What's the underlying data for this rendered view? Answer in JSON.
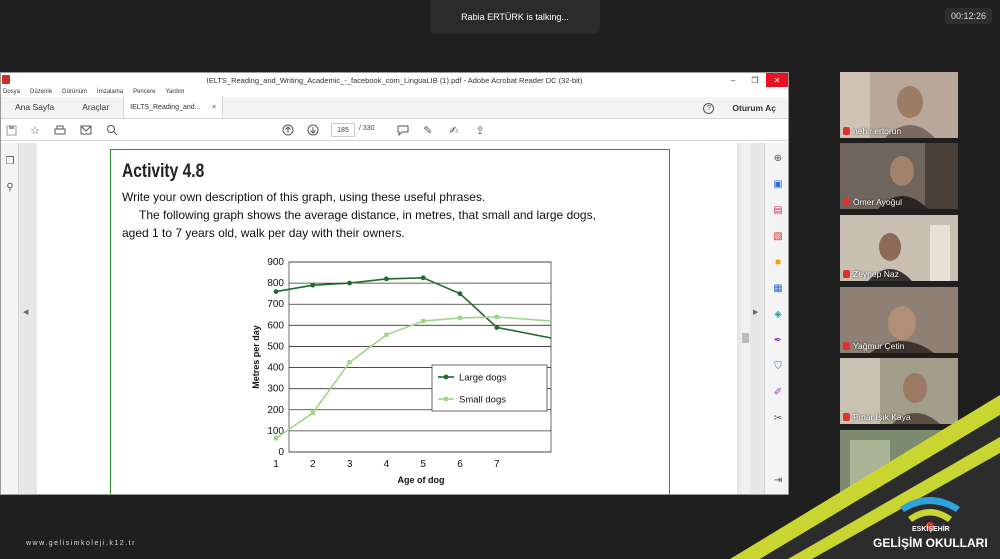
{
  "meeting": {
    "talking_label": "Rabia ERTÜRK is talking...",
    "timer": "00:12:26"
  },
  "acrobat": {
    "window_title": "IELTS_Reading_and_Writing_Academic_-_facebook_com_LinguaLIB (1).pdf - Adobe Acrobat Reader DC (32-bit)",
    "menu": [
      "Dosya",
      "Düzenle",
      "Görünüm",
      "İmzalama",
      "Pencere",
      "Yardım"
    ],
    "tabs": {
      "home": "Ana Sayfa",
      "tools": "Araçlar",
      "doc": "IELTS_Reading_and...",
      "doc_close": "×"
    },
    "help_label": "?",
    "signin": "Oturum Aç",
    "page_current": "185",
    "page_total": "/ 330",
    "window_controls": {
      "minimize": "–",
      "restore": "❐",
      "close": "✕"
    }
  },
  "activity": {
    "title": "Activity 4.8",
    "line1": "Write your own description of this graph, using these useful phrases.",
    "line2": "The following graph shows the average distance, in metres, that small and large dogs,",
    "line3": "aged 1 to 7 years old, walk per day with their owners."
  },
  "chart_data": {
    "type": "line",
    "title": "",
    "xlabel": "Age of dog",
    "ylabel": "Metres per day",
    "x": [
      1,
      2,
      3,
      4,
      5,
      6,
      7
    ],
    "ylim": [
      0,
      900
    ],
    "yticks": [
      0,
      100,
      200,
      300,
      400,
      500,
      600,
      700,
      800,
      900
    ],
    "grid": true,
    "legend_position": "center-right",
    "series": [
      {
        "name": "Large dogs",
        "color": "#1e6b2a",
        "marker": "circle",
        "values": [
          760,
          790,
          800,
          820,
          825,
          750,
          590
        ],
        "end_value": 540
      },
      {
        "name": "Small dogs",
        "color": "#9fd68a",
        "marker": "square",
        "values": [
          65,
          185,
          425,
          555,
          620,
          635,
          640
        ],
        "end_value": 620
      }
    ]
  },
  "participants": [
    {
      "name": "nehir ertorun",
      "bg": "#b9a89a"
    },
    {
      "name": "Ömer Ayoğul",
      "bg": "#6f655c"
    },
    {
      "name": "Zeynep Naz",
      "bg": "#c9bfb2"
    },
    {
      "name": "Yağmur Çetin",
      "bg": "#8f8075"
    },
    {
      "name": "Pınar Işık Kaya",
      "bg": "#a39d8c"
    },
    {
      "name": "",
      "bg": "#7c8a6f"
    }
  ],
  "branding": {
    "url": "www.gelisimkoleji.k12.tr",
    "school_city": "ESKİŞEHİR",
    "school_name": "GELİŞİM OKULLARI"
  }
}
